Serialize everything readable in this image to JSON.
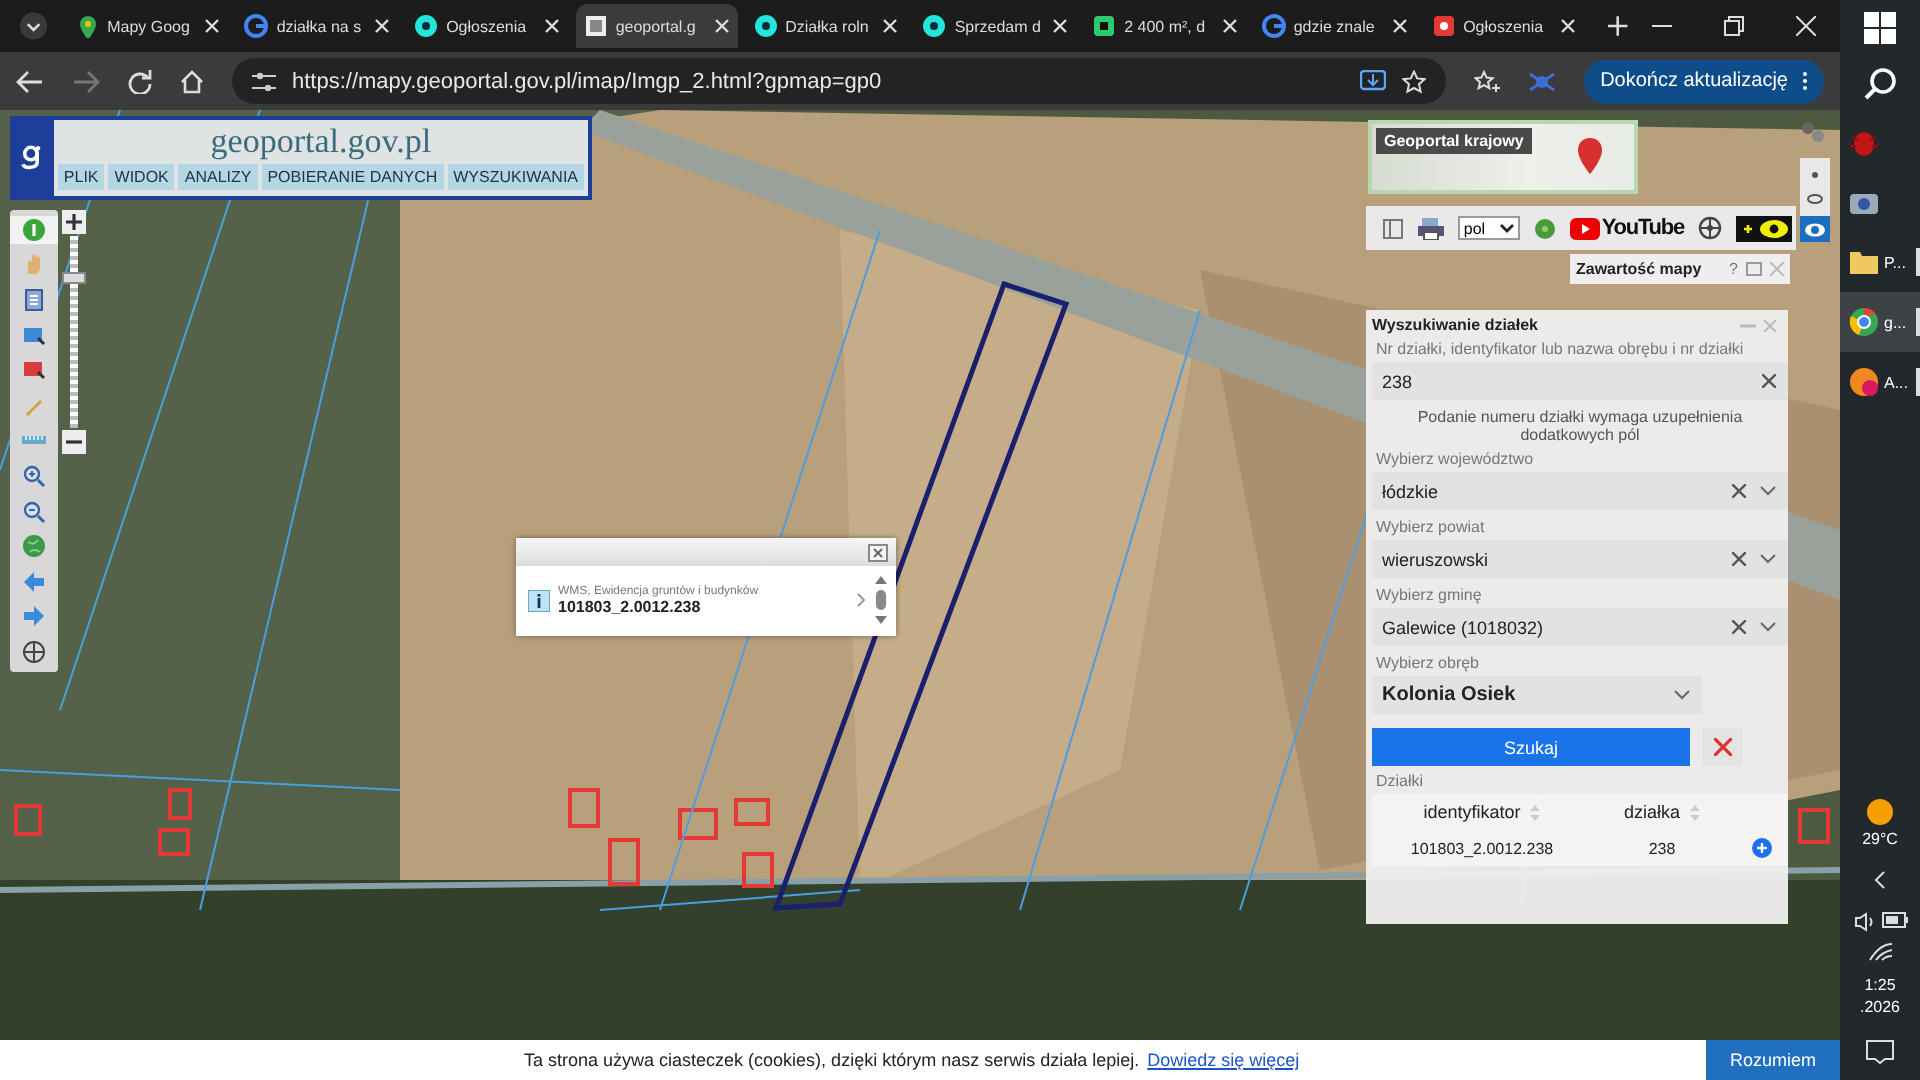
{
  "browser": {
    "tabs": [
      {
        "title": "Mapy Goog",
        "kind": "maps",
        "selected": false
      },
      {
        "title": "działka na s",
        "kind": "google",
        "selected": false
      },
      {
        "title": "Ogłoszenia",
        "kind": "olx",
        "selected": false
      },
      {
        "title": "geoportal.g",
        "kind": "page",
        "selected": true
      },
      {
        "title": "Działka roln",
        "kind": "olx",
        "selected": false
      },
      {
        "title": "Sprzedam d",
        "kind": "olx",
        "selected": false
      },
      {
        "title": "2 400 m², d",
        "kind": "green",
        "selected": false
      },
      {
        "title": "gdzie znale",
        "kind": "google",
        "selected": false
      },
      {
        "title": "Ogłoszenia",
        "kind": "red",
        "selected": false
      }
    ],
    "address": "https://mapy.geoportal.gov.pl/imap/Imgp_2.html?gpmap=gp0",
    "update_button": "Dokończ aktualizację"
  },
  "geoportal": {
    "site_title": "geoportal.gov.pl",
    "menu": [
      "PLIK",
      "WIDOK",
      "ANALIZY",
      "POBIERANIE DANYCH",
      "WYSZUKIWANIA"
    ],
    "zoom": {
      "level": 0.8
    },
    "popup": {
      "source": "WMS, Ewidencja gruntów i budynków",
      "parcel_id": "101803_2.0012.238"
    },
    "minimap": {
      "title": "Geoportal krajowy"
    },
    "language": "pol",
    "youtube": "YouTube",
    "map_contents": {
      "title": "Zawartość mapy",
      "help": "?"
    },
    "search": {
      "title": "Wyszukiwanie działek",
      "fields": [
        {
          "kind": "text",
          "label": "Nr działki, identyfikator lub nazwa obrębu i nr działki",
          "value": "238",
          "note": "Podanie numeru działki wymaga uzupełnienia dodatkowych pól"
        },
        {
          "kind": "select",
          "label": "Wybierz województwo",
          "value": "łódzkie",
          "clearable": true
        },
        {
          "kind": "select",
          "label": "Wybierz powiat",
          "value": "wieruszowski",
          "clearable": true
        },
        {
          "kind": "select",
          "label": "Wybierz gminę",
          "value": "Galewice (1018032)",
          "clearable": true
        },
        {
          "kind": "select",
          "label": "Wybierz obręb",
          "value": "Kolonia Osiek",
          "clearable": false
        }
      ],
      "button": "Szukaj",
      "results_label": "Działki",
      "columns": [
        "identyfikator",
        "działka"
      ],
      "rows": [
        [
          "101803_2.0012.238",
          "238"
        ]
      ]
    }
  },
  "cookie_bar": {
    "text": "Ta strona używa ciasteczek (cookies), dzięki którym nasz serwis działa lepiej.",
    "link": "Dowiedz się więcej",
    "button": "Rozumiem"
  },
  "taskbar": {
    "apps": [
      {
        "kind": "bug",
        "selected": false,
        "running": false
      },
      {
        "kind": "camera",
        "selected": false,
        "running": false
      },
      {
        "kind": "folder",
        "label": "P...",
        "selected": false,
        "running": true
      },
      {
        "kind": "chrome",
        "label": "g...",
        "selected": true,
        "running": true
      },
      {
        "kind": "app",
        "label": "A...",
        "selected": false,
        "running": true
      }
    ],
    "weather": "29°C",
    "time": "1:25",
    "date": ".2026"
  }
}
